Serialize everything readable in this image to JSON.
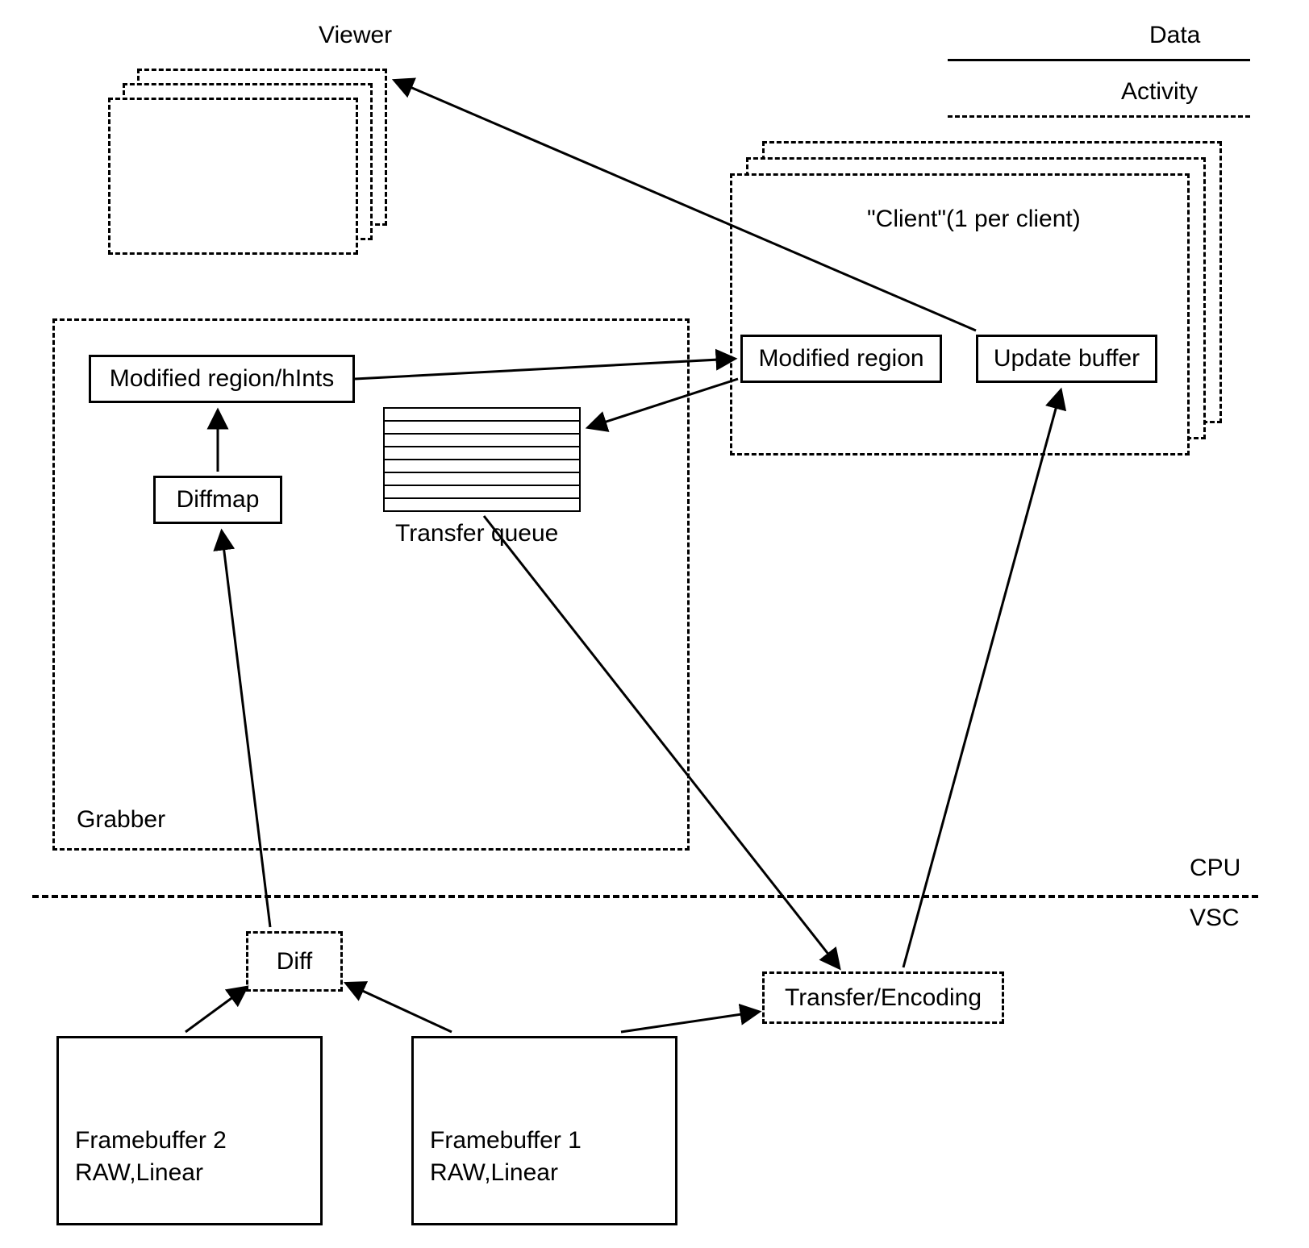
{
  "labels": {
    "viewer": "Viewer",
    "data": "Data",
    "activity": "Activity",
    "client": "\"Client\"(1 per client)",
    "modifiedRegionClient": "Modified region",
    "updateBuffer": "Update buffer",
    "modifiedRegionHints": "Modified region/hInts",
    "diffmap": "Diffmap",
    "transferQueue": "Transfer queue",
    "grabber": "Grabber",
    "cpu": "CPU",
    "vsc": "VSC",
    "diff": "Diff",
    "transferEncoding": "Transfer/Encoding",
    "fb2a": "Framebuffer 2",
    "fb2b": "RAW,Linear",
    "fb1a": "Framebuffer 1",
    "fb1b": "RAW,Linear"
  }
}
